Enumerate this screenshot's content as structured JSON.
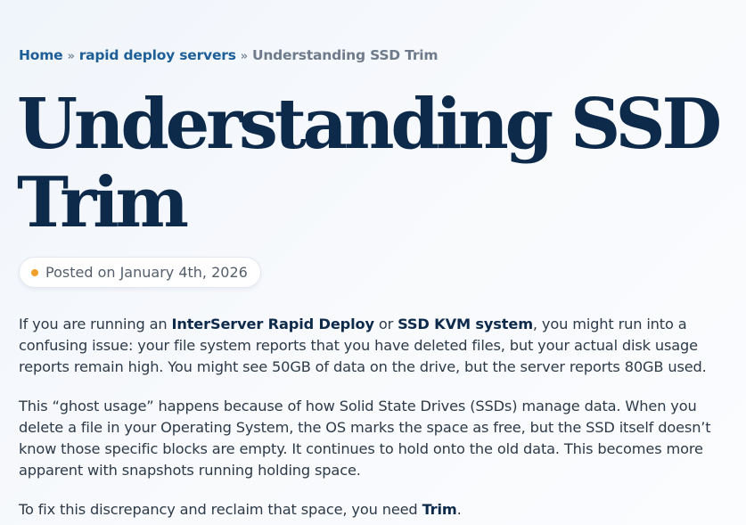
{
  "breadcrumb": {
    "home": "Home",
    "separator": "»",
    "category": "rapid deploy servers",
    "current": "Understanding SSD Trim"
  },
  "title_line1": "Understanding SSD",
  "title_line2": "Trim",
  "posted": {
    "text": "Posted on January 4th, 2026"
  },
  "paragraph1": {
    "part1": "If you are running an ",
    "bold1": "InterServer Rapid Deploy",
    "part2": " or ",
    "bold2": "SSD KVM system",
    "part3": ", you might run into a confusing issue: your file system reports that you have deleted files, but your actual disk usage reports remain high. You might see 50GB of data on the drive, but the server reports 80GB used."
  },
  "paragraph2": "This “ghost usage” happens because of how Solid State Drives (SSDs) manage data. When you delete a file in your Operating System, the OS marks the space as free, but the SSD itself doesn’t know those specific blocks are empty. It continues to hold onto the old data. This becomes more apparent with snapshots running holding space.",
  "paragraph3": {
    "part1": "To fix this discrepancy and reclaim that space, you need ",
    "bold1": "Trim",
    "part2": "."
  },
  "colors": {
    "link": "#1d5f96",
    "title": "#0e2a4b",
    "dot": "#f0a02a"
  }
}
